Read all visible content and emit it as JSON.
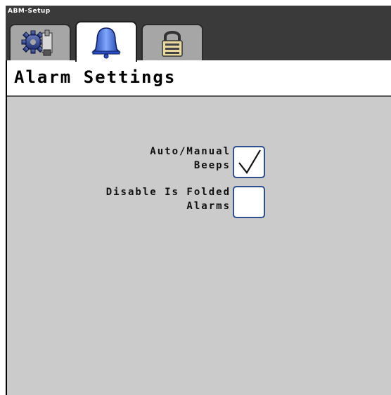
{
  "window": {
    "title": "ABM-Setup"
  },
  "tabs": [
    {
      "icon": "gear-wrench-icon",
      "active": false
    },
    {
      "icon": "bell-icon",
      "active": true
    },
    {
      "icon": "padlock-icon",
      "active": false
    }
  ],
  "page": {
    "title": "Alarm Settings"
  },
  "settings": [
    {
      "label": "Auto/Manual\nBeeps",
      "checked": true
    },
    {
      "label": "Disable Is Folded\nAlarms",
      "checked": false
    }
  ],
  "colors": {
    "content_bg": "#cbcbcb",
    "checkbox_border": "#2f4f8f",
    "tab_inactive": "#a6a6a6",
    "tab_active": "#ffffff",
    "frame": "#000000"
  }
}
